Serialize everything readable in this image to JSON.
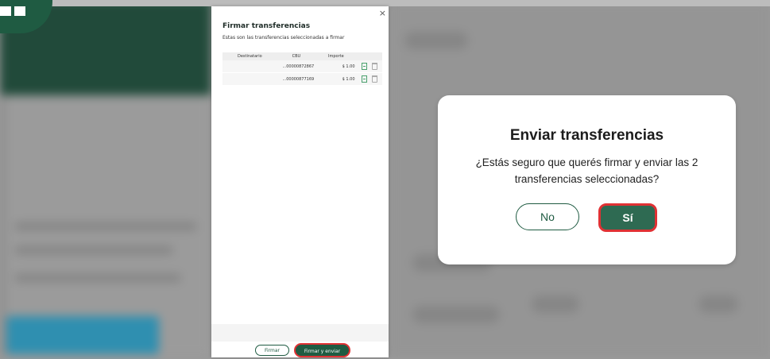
{
  "drawer": {
    "close_symbol": "×",
    "title": "Firmar transferencias",
    "subtitle": "Estas son las transferencias seleccionadas a firmar",
    "columns": [
      "Destinatario",
      "CBU",
      "Importe",
      ""
    ],
    "rows": [
      {
        "destinatario": "",
        "cbu": "...00000872867",
        "importe": "$ 1.00"
      },
      {
        "destinatario": "",
        "cbu": "...00000877169",
        "importe": "$ 1.00"
      }
    ],
    "firmar_label": "Firmar",
    "firmar_enviar_label": "Firmar y enviar"
  },
  "dialog": {
    "title": "Enviar transferencias",
    "message": "¿Estás seguro que querés firmar y enviar las 2 transferencias seleccionadas?",
    "no_label": "No",
    "si_label": "Sí"
  },
  "colors": {
    "brand_green": "#1f5b42",
    "highlight_red": "#e03134"
  }
}
